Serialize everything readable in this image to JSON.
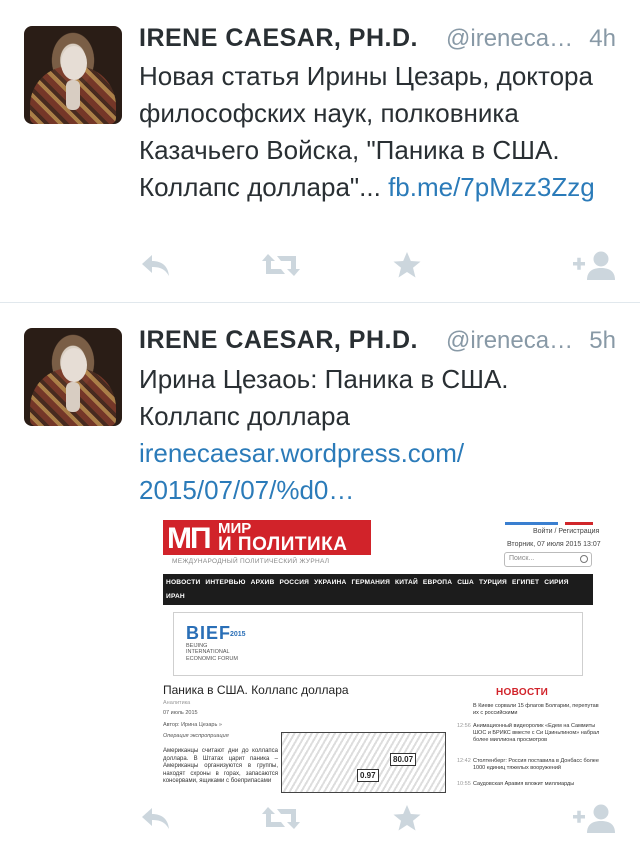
{
  "tweets": [
    {
      "name": "IRENE CAESAR, PH.D.",
      "handle": "@ireneca…",
      "time": "4h",
      "text": "Новая статья Ирины Цезарь, доктора философских наук, полковника Казачьего Войска, \"Паника в США. Коллапс доллара\"...",
      "link": "fb.me/7pMzz3Zzg"
    },
    {
      "name": "IRENE CAESAR, PH.D.",
      "handle": "@ireneca…",
      "time": "5h",
      "text": "Ирина Цезаоь: Паника в США. Коллапс доллара",
      "link": "irenecaesar.wordpress.com/ 2015/07/07/%d0…",
      "embed": {
        "logo_abbr": "МП",
        "logo_line1": "МИР",
        "logo_line2": "И ПОЛИТИКА",
        "logo_subtitle": "МЕЖДУНАРОДНЫЙ ПОЛИТИЧЕСКИЙ ЖУРНАЛ",
        "login": "Войти / Регистрация",
        "date": "Вторник, 07 июля 2015 13:07",
        "search_placeholder": "Поиск...",
        "nav_row1": [
          "НОВОСТИ",
          "ИНТЕРВЬЮ",
          "АРХИВ",
          "РОССИЯ",
          "УКРАИНА",
          "ГЕРМАНИЯ",
          "КИТАЙ",
          "ЕВРОПА",
          "США",
          "ТУРЦИЯ",
          "ЕГИПЕТ",
          "СИРИЯ"
        ],
        "nav_row2": [
          "ИРАН"
        ],
        "banner_title": "BIEF",
        "banner_year": "2015",
        "banner_sub": "BEIJING INTERNATIONAL ECONOMIC FORUM",
        "article_title": "Паника в США. Коллапс доллара",
        "article_category": "Аналитика",
        "article_date": "07 июль 2015",
        "article_author": "Автор:    Ирина Цезарь »",
        "article_tag": "Операция экспроприация",
        "article_body": "Американцы считают дни до коллапса доллара. В Штатах царит паника – Американцы организуются в группы, находят схроны в горах, запасаются консервами, ящиками с боеприпасами",
        "cartoon_labels": [
          "80.07",
          "0.97"
        ],
        "news_heading": "НОВОСТИ",
        "news": [
          {
            "time": "",
            "text": "В Киеве сорвали 15 флагов Болгарии, перепутав их с российскими"
          },
          {
            "time": "12:56",
            "text": "Анимационный видеоролик «Едем на Саммиты ШОС и БРИКС вместе с Си Цзиньпином» набрал более миллиона просмотров"
          },
          {
            "time": "12:42",
            "text": "Столтенберг: Россия поставила в Донбасс более 1000 единиц тяжелых вооружений"
          },
          {
            "time": "10:55",
            "text": "Саудовская Аравия вложит миллиарды"
          }
        ]
      }
    }
  ],
  "actions": [
    "reply-icon",
    "retweet-icon",
    "favorite-icon",
    "follow-icon"
  ],
  "colors": {
    "link": "#2b7bb9",
    "muted": "#8899a6",
    "icon": "#ccd6dd",
    "brand_red": "#d1232a"
  }
}
